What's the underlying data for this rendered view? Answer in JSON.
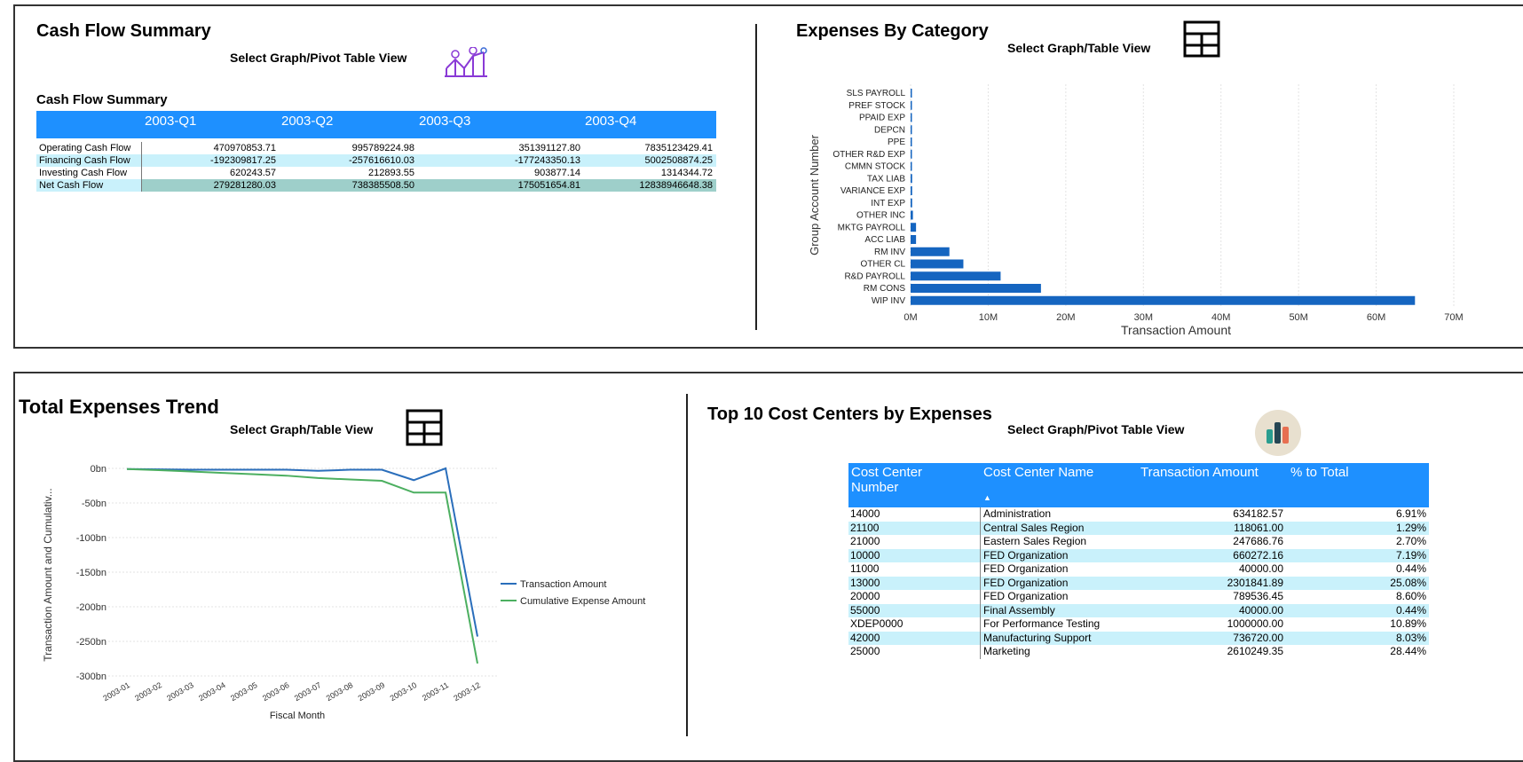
{
  "cash_flow": {
    "title": "Cash Flow Summary",
    "selector_label": "Select Graph/Pivot Table View",
    "table_title": "Cash Flow Summary",
    "columns": [
      "2003-Q1",
      "2003-Q2",
      "2003-Q3",
      "2003-Q4"
    ],
    "rows": [
      {
        "label": "Operating Cash Flow",
        "values": [
          "470970853.71",
          "995789224.98",
          "351391127.80",
          "7835123429.41"
        ]
      },
      {
        "label": "Financing Cash Flow",
        "values": [
          "-192309817.25",
          "-257616610.03",
          "-177243350.13",
          "5002508874.25"
        ]
      },
      {
        "label": "Investing Cash Flow",
        "values": [
          "620243.57",
          "212893.55",
          "903877.14",
          "1314344.72"
        ]
      }
    ],
    "total": {
      "label": "Net Cash Flow",
      "values": [
        "279281280.03",
        "738385508.50",
        "175051654.81",
        "12838946648.38"
      ]
    }
  },
  "expenses_category": {
    "title": "Expenses By Category",
    "selector_label": "Select Graph/Table View",
    "icon": "table-grid-icon"
  },
  "expenses_trend": {
    "title": "Total Expenses Trend",
    "selector_label": "Select Graph/Table View",
    "icon": "table-grid-icon"
  },
  "cost_centers": {
    "title": "Top 10 Cost Centers by Expenses",
    "selector_label": "Select Graph/Pivot Table View",
    "icon": "bar-chart-icon",
    "headers": [
      "Cost Center Number",
      "Cost Center Name",
      "Transaction Amount",
      "% to Total"
    ],
    "rows": [
      [
        "14000",
        "Administration",
        "634182.57",
        "6.91%"
      ],
      [
        "21100",
        "Central Sales Region",
        "118061.00",
        "1.29%"
      ],
      [
        "21000",
        "Eastern Sales Region",
        "247686.76",
        "2.70%"
      ],
      [
        "10000",
        "FED Organization",
        "660272.16",
        "7.19%"
      ],
      [
        "11000",
        "FED Organization",
        "40000.00",
        "0.44%"
      ],
      [
        "13000",
        "FED Organization",
        "2301841.89",
        "25.08%"
      ],
      [
        "20000",
        "FED Organization",
        "789536.45",
        "8.60%"
      ],
      [
        "55000",
        "Final Assembly",
        "40000.00",
        "0.44%"
      ],
      [
        "XDEP0000",
        "For Performance Testing",
        "1000000.00",
        "10.89%"
      ],
      [
        "42000",
        "Manufacturing Support",
        "736720.00",
        "8.03%"
      ],
      [
        "25000",
        "Marketing",
        "2610249.35",
        "28.44%"
      ]
    ]
  },
  "chart_data": [
    {
      "type": "bar",
      "orientation": "horizontal",
      "xlabel": "Transaction Amount",
      "ylabel": "Group Account Number",
      "categories": [
        "SLS PAYROLL",
        "PREF STOCK",
        "PPAID EXP",
        "DEPCN",
        "PPE",
        "OTHER R&D EXP",
        "CMMN STOCK",
        "TAX LIAB",
        "VARIANCE EXP",
        "INT EXP",
        "OTHER INC",
        "MKTG PAYROLL",
        "ACC LIAB",
        "RM INV",
        "OTHER CL",
        "R&D PAYROLL",
        "RM CONS",
        "WIP INV"
      ],
      "values": [
        0.1,
        0.1,
        0.1,
        0.1,
        0.1,
        0.15,
        0.15,
        0.2,
        0.2,
        0.2,
        0.3,
        0.7,
        0.7,
        5.0,
        6.8,
        11.6,
        16.8,
        65.0
      ],
      "units": "M",
      "xticks": [
        "0M",
        "10M",
        "20M",
        "30M",
        "40M",
        "50M",
        "60M",
        "70M"
      ],
      "xlim": [
        0,
        70
      ],
      "color": "#1565c0"
    },
    {
      "type": "line",
      "xlabel": "Fiscal Month",
      "ylabel": "Transaction Amount and Cumulativ...",
      "x": [
        "2003-01",
        "2003-02",
        "2003-03",
        "2003-04",
        "2003-05",
        "2003-06",
        "2003-07",
        "2003-08",
        "2003-09",
        "2003-10",
        "2003-11",
        "2003-12"
      ],
      "yticks": [
        "0bn",
        "-50bn",
        "-100bn",
        "-150bn",
        "-200bn",
        "-250bn",
        "-300bn"
      ],
      "ylim": [
        -300,
        0
      ],
      "series": [
        {
          "name": "Transaction Amount",
          "color": "#2a6ebb",
          "values": [
            -1,
            -1.5,
            -2,
            -2,
            -2,
            -2,
            -3.5,
            -2,
            -2,
            -17,
            0,
            -243
          ]
        },
        {
          "name": "Cumulative Expense Amount",
          "color": "#4caf60",
          "values": [
            -1,
            -2.5,
            -4.5,
            -6.5,
            -8.5,
            -10.5,
            -14,
            -16,
            -18,
            -35,
            -35,
            -282
          ]
        }
      ]
    }
  ]
}
